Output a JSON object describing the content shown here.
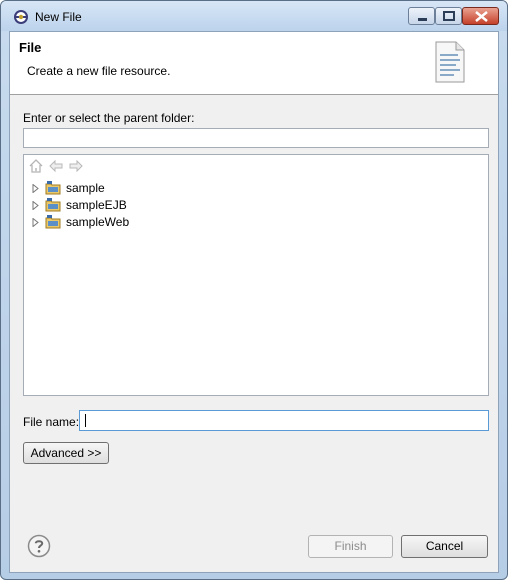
{
  "window": {
    "title": "New File"
  },
  "banner": {
    "title": "File",
    "description": "Create a new file resource."
  },
  "parent_folder": {
    "label": "Enter or select the parent folder:",
    "value": ""
  },
  "tree": {
    "items": [
      {
        "label": "sample"
      },
      {
        "label": "sampleEJB"
      },
      {
        "label": "sampleWeb"
      }
    ]
  },
  "file_name": {
    "label": "File name:",
    "value": ""
  },
  "buttons": {
    "advanced": "Advanced >>",
    "finish": "Finish",
    "cancel": "Cancel"
  }
}
